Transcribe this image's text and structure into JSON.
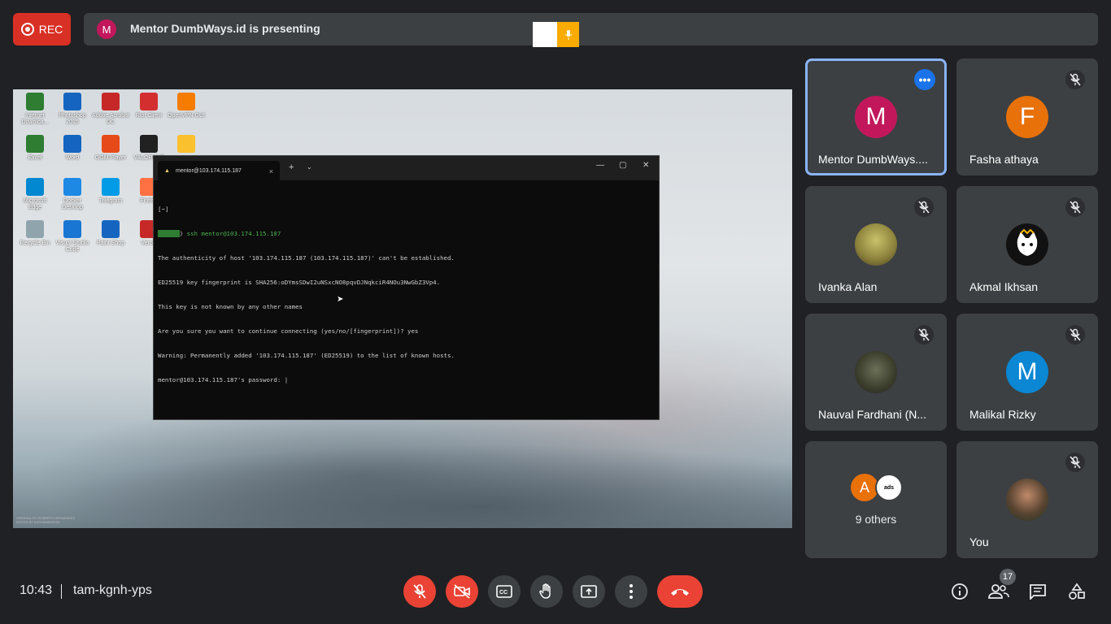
{
  "recording": {
    "label": "REC"
  },
  "presenter": {
    "initial": "M",
    "text": "Mentor DumbWays.id is presenting"
  },
  "desktop": {
    "icons": [
      {
        "label": "Internet Downloa...",
        "color": "#2e7d32"
      },
      {
        "label": "Photoshop 2015",
        "color": "#1565c0"
      },
      {
        "label": "Adobe Acrobat DC",
        "color": "#c62828"
      },
      {
        "label": "Riot Client",
        "color": "#d32f2f"
      },
      {
        "label": "OpenVPN GUI",
        "color": "#f57c00"
      },
      {
        "label": "Excel",
        "color": "#2e7d32"
      },
      {
        "label": "Word",
        "color": "#1565c0"
      },
      {
        "label": "GOM Player",
        "color": "#e64a19"
      },
      {
        "label": "VALORANT",
        "color": "#212121"
      },
      {
        "label": "",
        "color": "#fbc02d"
      },
      {
        "label": "Microsoft Edge",
        "color": "#0288d1"
      },
      {
        "label": "Docker Desktop",
        "color": "#1e88e5"
      },
      {
        "label": "Telegram",
        "color": "#039be5"
      },
      {
        "label": "Firefox",
        "color": "#ff7043"
      },
      {
        "label": "Recycle Bin",
        "color": "#90a4ae"
      },
      {
        "label": "Visual Studio Code",
        "color": "#1976d2"
      },
      {
        "label": "Paint Shop",
        "color": "#1565c0"
      },
      {
        "label": "Vercel",
        "color": "#c62828"
      }
    ],
    "watermark": "ORIGINAL BY ROBERTO HERNANDEZ\nEDITED BY ASSHAMEDRON"
  },
  "terminal": {
    "tab_title": "mentor@103.174.115.187",
    "lines": [
      "[~]",
      "ssh mentor@103.174.115.187",
      "The authenticity of host '103.174.115.187 (103.174.115.187)' can't be established.",
      "ED25519 key fingerprint is SHA256:oDYmsSDwI2uNSxcNO8pqvDJNqkciR4NOu3NwGbZ3Vp4.",
      "This key is not known by any other names",
      "Are you sure you want to continue connecting (yes/no/[fingerprint])? yes",
      "Warning: Permanently added '103.174.115.187' (ED25519) to the list of known hosts.",
      "mentor@103.174.115.187's password: |"
    ]
  },
  "participants": [
    {
      "name": "Mentor DumbWays....",
      "initial": "M",
      "color": "#c2185b",
      "active": true
    },
    {
      "name": "Fasha athaya",
      "initial": "F",
      "color": "#e8710a"
    },
    {
      "name": "Ivanka Alan",
      "photo": "photo"
    },
    {
      "name": "Akmal Ikhsan",
      "photo": "cat"
    },
    {
      "name": "Nauval Fardhani (N...",
      "photo": "photo2"
    },
    {
      "name": "Malikal Rizky",
      "initial": "M",
      "color": "#0b87d3"
    },
    {
      "others_label": "9 others",
      "initial": "A",
      "color": "#e8710a",
      "second_label": "ads"
    },
    {
      "name": "You",
      "photo": "photo3"
    }
  ],
  "bottom": {
    "time": "10:43",
    "meeting_code": "tam-kgnh-yps",
    "participant_count": "17"
  },
  "colors": {
    "accent": "#8ab4f8",
    "danger": "#ea4335",
    "surface": "#3c4043",
    "background": "#202124"
  }
}
